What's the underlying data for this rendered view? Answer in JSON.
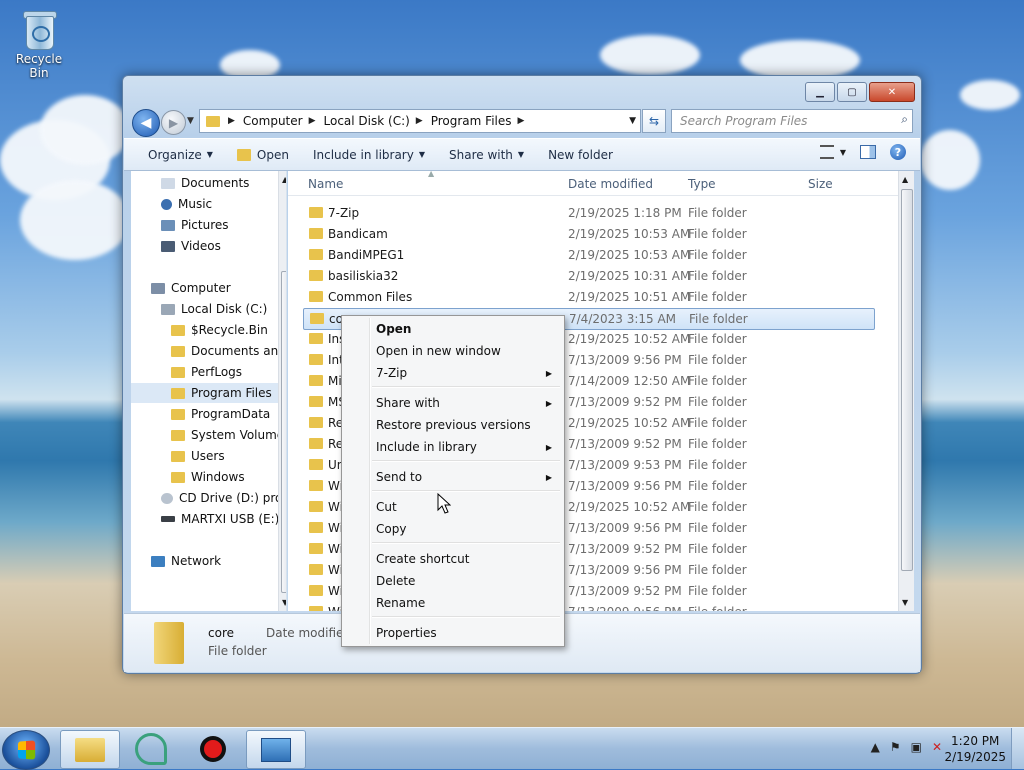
{
  "desktop": {
    "recycle_bin_label": "Recycle Bin"
  },
  "window": {
    "controls": {
      "minimize": "▁",
      "maximize": "▢",
      "close": "✕"
    },
    "address": [
      "Computer",
      "Local Disk (C:)",
      "Program Files"
    ],
    "search_placeholder": "Search Program Files",
    "toolbar": {
      "organize": "Organize",
      "open": "Open",
      "include_in_library": "Include in library",
      "share_with": "Share with",
      "new_folder": "New folder"
    },
    "nav": {
      "items": [
        "Documents",
        "Music",
        "Pictures",
        "Videos",
        "Computer",
        "Local Disk (C:)",
        "$Recycle.Bin",
        "Documents and",
        "PerfLogs",
        "Program Files",
        "ProgramData",
        "System Volume",
        "Users",
        "Windows",
        "CD Drive (D:) pro",
        "MARTXI USB (E:)",
        "Network"
      ]
    },
    "columns": {
      "name": "Name",
      "date": "Date modified",
      "type": "Type",
      "size": "Size"
    },
    "files": [
      {
        "name": "7-Zip",
        "date": "2/19/2025 1:18 PM",
        "type": "File folder"
      },
      {
        "name": "Bandicam",
        "date": "2/19/2025 10:53 AM",
        "type": "File folder"
      },
      {
        "name": "BandiMPEG1",
        "date": "2/19/2025 10:53 AM",
        "type": "File folder"
      },
      {
        "name": "basiliskia32",
        "date": "2/19/2025 10:31 AM",
        "type": "File folder"
      },
      {
        "name": "Common Files",
        "date": "2/19/2025 10:51 AM",
        "type": "File folder"
      },
      {
        "name": "co",
        "date": "7/4/2023 3:15 AM",
        "type": "File folder"
      },
      {
        "name": "Ins",
        "date": "2/19/2025 10:52 AM",
        "type": "File folder"
      },
      {
        "name": "Int",
        "date": "7/13/2009 9:56 PM",
        "type": "File folder"
      },
      {
        "name": "Mi",
        "date": "7/14/2009 12:50 AM",
        "type": "File folder"
      },
      {
        "name": "MS",
        "date": "7/13/2009 9:52 PM",
        "type": "File folder"
      },
      {
        "name": "Re",
        "date": "2/19/2025 10:52 AM",
        "type": "File folder"
      },
      {
        "name": "Re",
        "date": "7/13/2009 9:52 PM",
        "type": "File folder"
      },
      {
        "name": "Un",
        "date": "7/13/2009 9:53 PM",
        "type": "File folder"
      },
      {
        "name": "Wi",
        "date": "7/13/2009 9:56 PM",
        "type": "File folder"
      },
      {
        "name": "Wi",
        "date": "2/19/2025 10:52 AM",
        "type": "File folder"
      },
      {
        "name": "Wi",
        "date": "7/13/2009 9:56 PM",
        "type": "File folder"
      },
      {
        "name": "Wi",
        "date": "7/13/2009 9:52 PM",
        "type": "File folder"
      },
      {
        "name": "Wi",
        "date": "7/13/2009 9:56 PM",
        "type": "File folder"
      },
      {
        "name": "Wi",
        "date": "7/13/2009 9:52 PM",
        "type": "File folder"
      },
      {
        "name": "Wi",
        "date": "7/13/2009 9:56 PM",
        "type": "File folder"
      }
    ],
    "details": {
      "name": "core",
      "type": "File folder",
      "date_label": "Date modified"
    }
  },
  "context_menu": {
    "open": "Open",
    "open_new_window": "Open in new window",
    "seven_zip": "7-Zip",
    "share_with": "Share with",
    "restore_previous": "Restore previous versions",
    "include_in_library": "Include in library",
    "send_to": "Send to",
    "cut": "Cut",
    "copy": "Copy",
    "create_shortcut": "Create shortcut",
    "delete": "Delete",
    "rename": "Rename",
    "properties": "Properties"
  },
  "taskbar": {
    "time": "1:20 PM",
    "date": "2/19/2025"
  }
}
